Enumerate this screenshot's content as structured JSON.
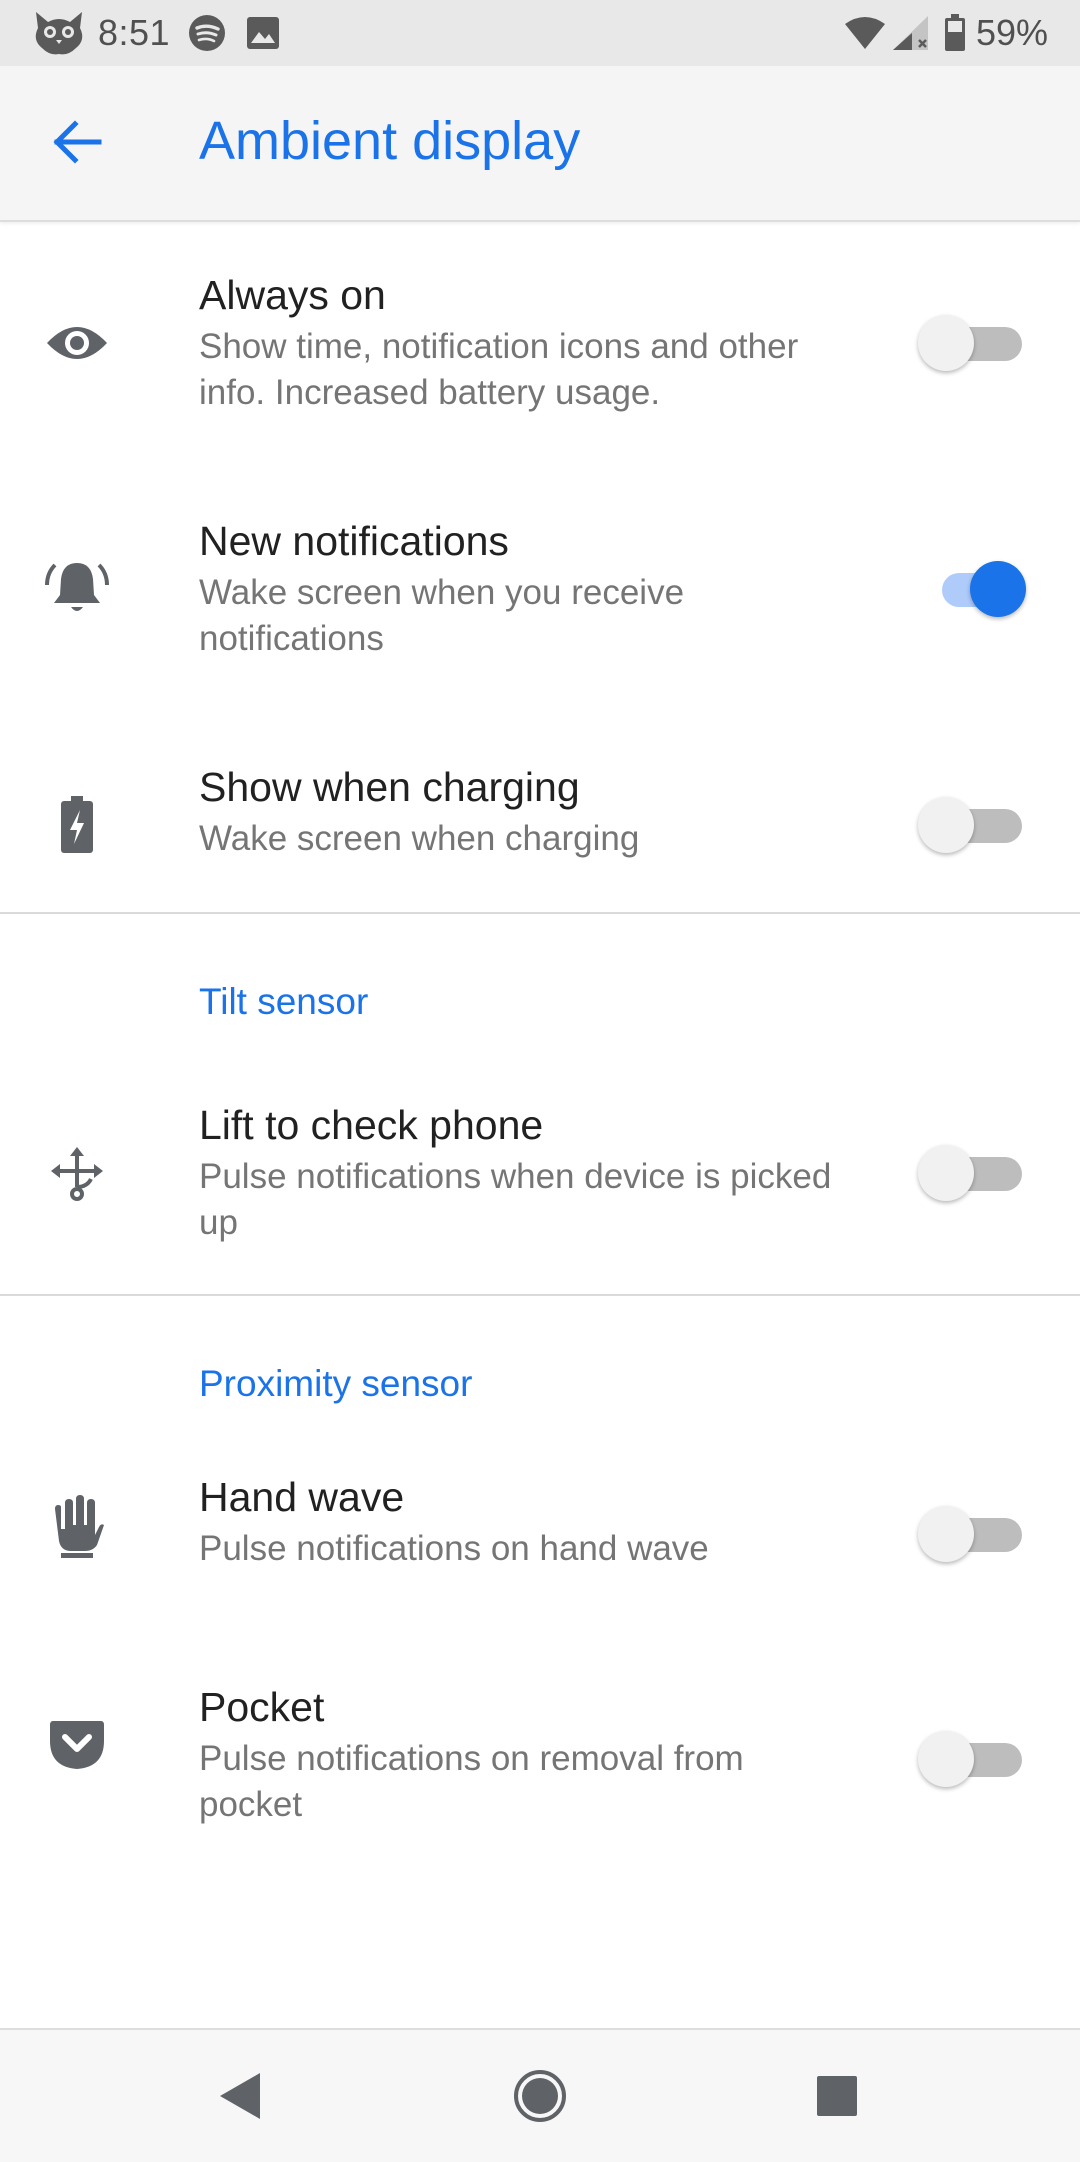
{
  "status_bar": {
    "time": "8:51",
    "battery_percent": "59%",
    "left_icons": [
      "owl-notification-icon",
      "spotify-icon",
      "image-icon"
    ],
    "right_icons": [
      "wifi-icon",
      "cellular-signal-icon",
      "battery-icon"
    ]
  },
  "toolbar": {
    "title": "Ambient display",
    "back_icon": "arrow-back-icon"
  },
  "settings": [
    {
      "icon": "eye-icon",
      "title": "Always on",
      "summary": "Show time, notification icons and other info. Increased battery usage.",
      "enabled": false
    },
    {
      "icon": "bell-ringing-icon",
      "title": "New notifications",
      "summary": "Wake screen when you receive notifications",
      "enabled": true
    },
    {
      "icon": "battery-charging-icon",
      "title": "Show when charging",
      "summary": "Wake screen when charging",
      "enabled": false
    }
  ],
  "sections": {
    "tilt": {
      "header": "Tilt sensor",
      "items": [
        {
          "icon": "device-move-icon",
          "title": "Lift to check phone",
          "summary": "Pulse notifications when device is picked up",
          "enabled": false
        }
      ]
    },
    "proximity": {
      "header": "Proximity sensor",
      "items": [
        {
          "icon": "hand-wave-icon",
          "title": "Hand wave",
          "summary": "Pulse notifications on hand wave",
          "enabled": false
        },
        {
          "icon": "pocket-icon",
          "title": "Pocket",
          "summary": "Pulse notifications on removal from pocket",
          "enabled": false
        }
      ]
    }
  },
  "nav_bar": {
    "buttons": [
      "back-triangle-icon",
      "home-circle-icon",
      "recents-square-icon"
    ]
  },
  "colors": {
    "accent": "#1a73e8",
    "switch_on_track": "#aecbfa",
    "switch_off_thumb": "#f1f1f1",
    "switch_off_track": "#bdbdbd",
    "summary_text": "#757575",
    "status_bar_bg": "#e8e8e8",
    "toolbar_bg": "#f5f5f5"
  }
}
